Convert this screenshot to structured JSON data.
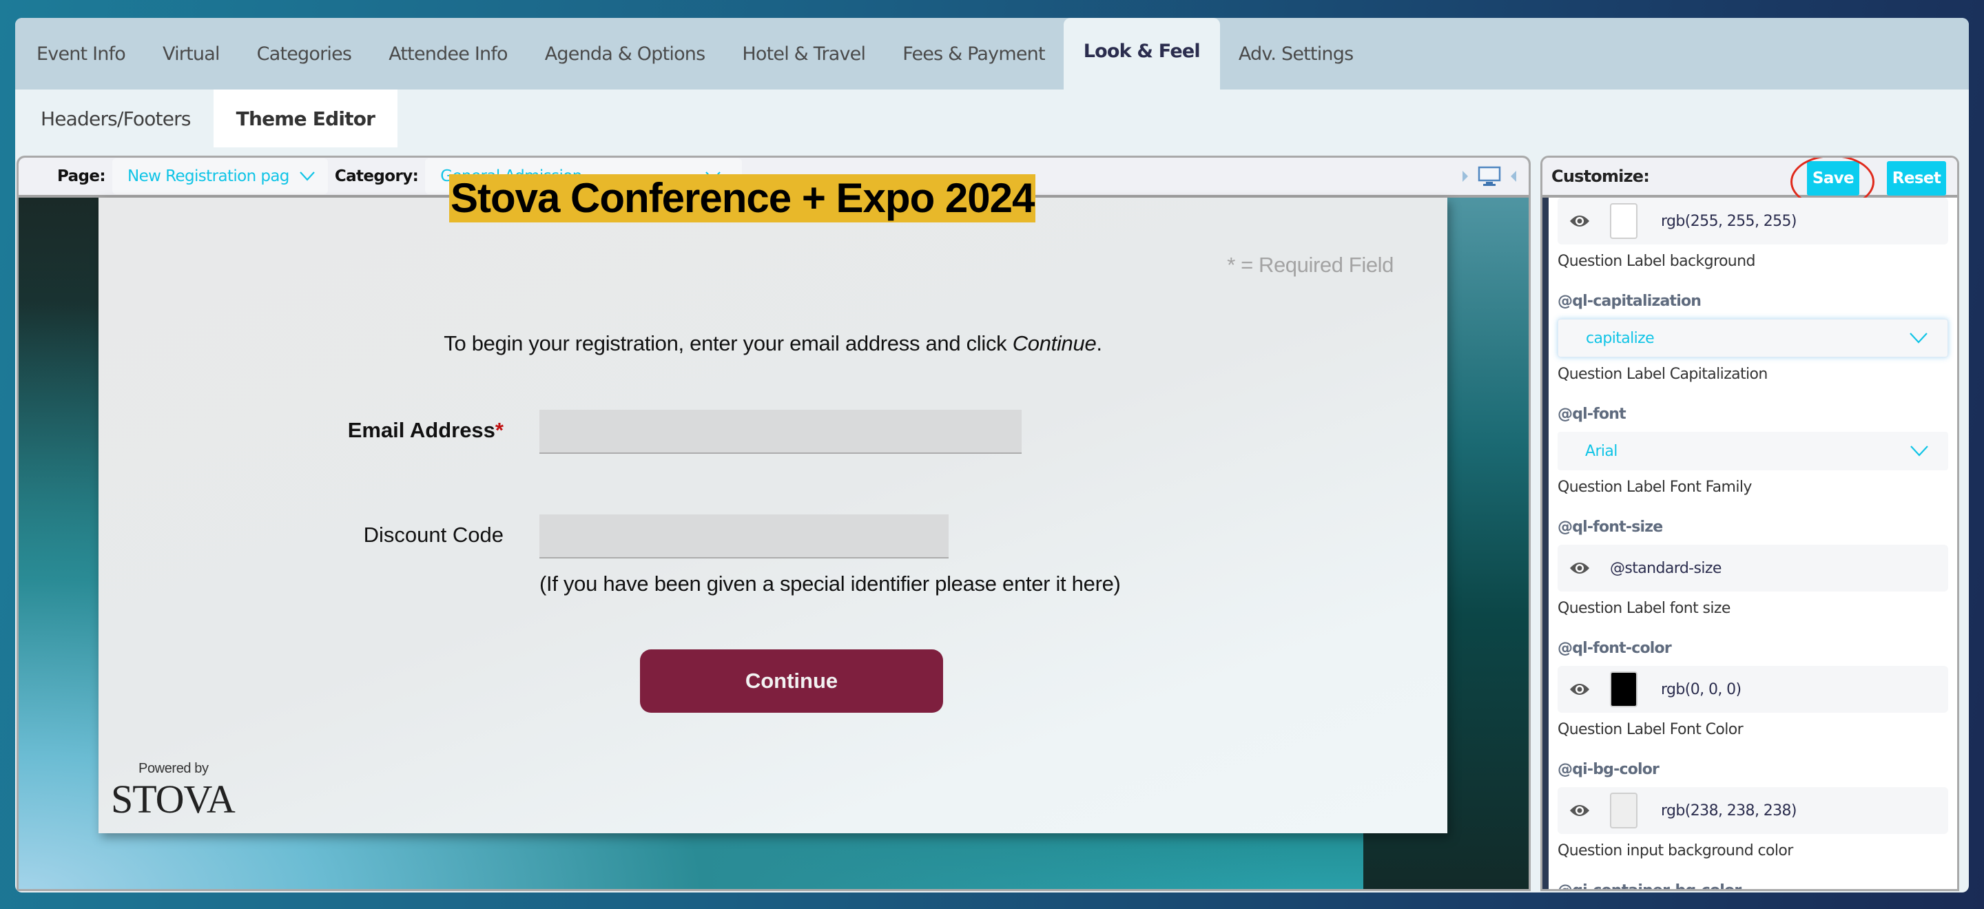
{
  "tabs": [
    {
      "label": "Event Info",
      "active": false
    },
    {
      "label": "Virtual",
      "active": false
    },
    {
      "label": "Categories",
      "active": false
    },
    {
      "label": "Attendee Info",
      "active": false
    },
    {
      "label": "Agenda & Options",
      "active": false
    },
    {
      "label": "Hotel & Travel",
      "active": false
    },
    {
      "label": "Fees & Payment",
      "active": false
    },
    {
      "label": "Look & Feel",
      "active": true
    },
    {
      "label": "Adv. Settings",
      "active": false
    }
  ],
  "subtabs": [
    {
      "label": "Headers/Footers",
      "active": false
    },
    {
      "label": "Theme Editor",
      "active": true
    }
  ],
  "preview_toolbar": {
    "page_label": "Page:",
    "page_value": "New Registration pag",
    "category_label": "Category:",
    "category_value": "General Admission",
    "device_icon": "desktop-monitor-icon"
  },
  "preview_page": {
    "event_title": "Stova Conference + Expo 2024",
    "required_note": "* = Required Field",
    "intro_text": "To begin your registration, enter your email address and click ",
    "intro_em": "Continue",
    "intro_end": ".",
    "email_label": "Email Address",
    "required_marker": "*",
    "email_value": "",
    "discount_label": "Discount Code",
    "discount_value": "",
    "discount_hint": "(If you have been given a special identifier please enter it here)",
    "continue_label": "Continue",
    "powered_by": "Powered by",
    "brand": "STOVA",
    "colors": {
      "title_highlight": "#e8b82a",
      "continue_button": "#7e1f3e",
      "required_star": "#c01010"
    }
  },
  "customize": {
    "title": "Customize:",
    "save_label": "Save",
    "reset_label": "Reset",
    "accent": "#0ccdef",
    "properties": [
      {
        "variable": "",
        "type": "color",
        "value": "rgb(255, 255, 255)",
        "swatch": "#ffffff",
        "description": "Question Label background"
      },
      {
        "variable": "@ql-capitalization",
        "type": "select",
        "value": "capitalize",
        "description": "Question Label Capitalization"
      },
      {
        "variable": "@ql-font",
        "type": "select",
        "value": "Arial",
        "description": "Question Label Font Family"
      },
      {
        "variable": "@ql-font-size",
        "type": "text",
        "value": "@standard-size",
        "description": "Question Label font size"
      },
      {
        "variable": "@ql-font-color",
        "type": "color",
        "value": "rgb(0, 0, 0)",
        "swatch": "#000000",
        "description": "Question Label Font Color"
      },
      {
        "variable": "@qi-bg-color",
        "type": "color",
        "value": "rgb(238, 238, 238)",
        "swatch": "#eeeeee",
        "description": "Question input background color"
      },
      {
        "variable": "@qi-container-bg-color",
        "type": "partial",
        "value": "",
        "description": ""
      }
    ]
  }
}
